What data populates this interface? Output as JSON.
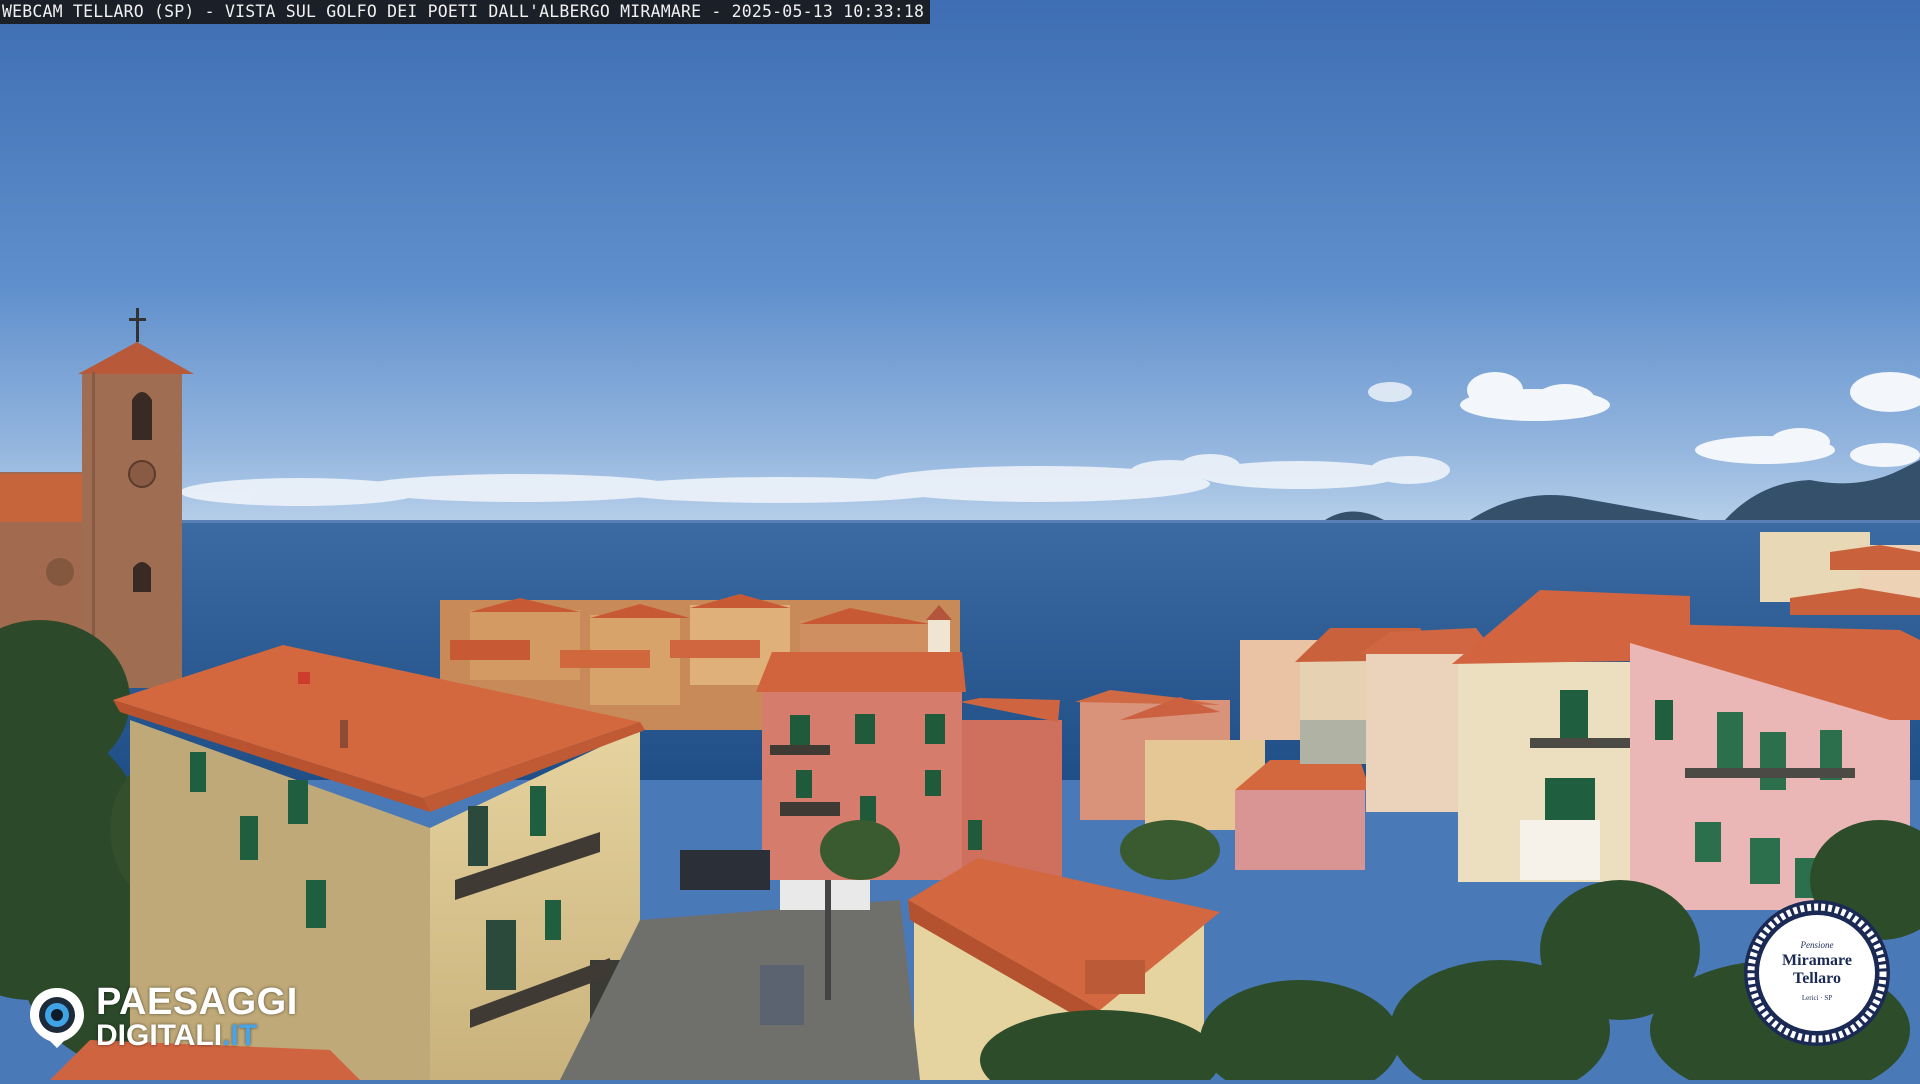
{
  "overlay": {
    "caption": "WEBCAM TELLARO (SP) - VISTA SUL GOLFO DEI POETI DALL'ALBERGO MIRAMARE - 2025-05-13 10:33:18"
  },
  "watermark": {
    "brand_line1": "PAESAGGI",
    "brand_line2_main": "DIGITALI",
    "brand_line2_suffix": ".IT"
  },
  "hotel_badge": {
    "top": "Pensione",
    "name_line1": "Miramare",
    "name_line2": "Tellaro",
    "bottom": "Lerici · SP"
  },
  "colors": {
    "sky_top": "#3f6fb4",
    "sky_horizon": "#a9c6e6",
    "sea": "#2a5c94",
    "roof": "#d9683f",
    "brand_accent": "#4aa3e8"
  }
}
